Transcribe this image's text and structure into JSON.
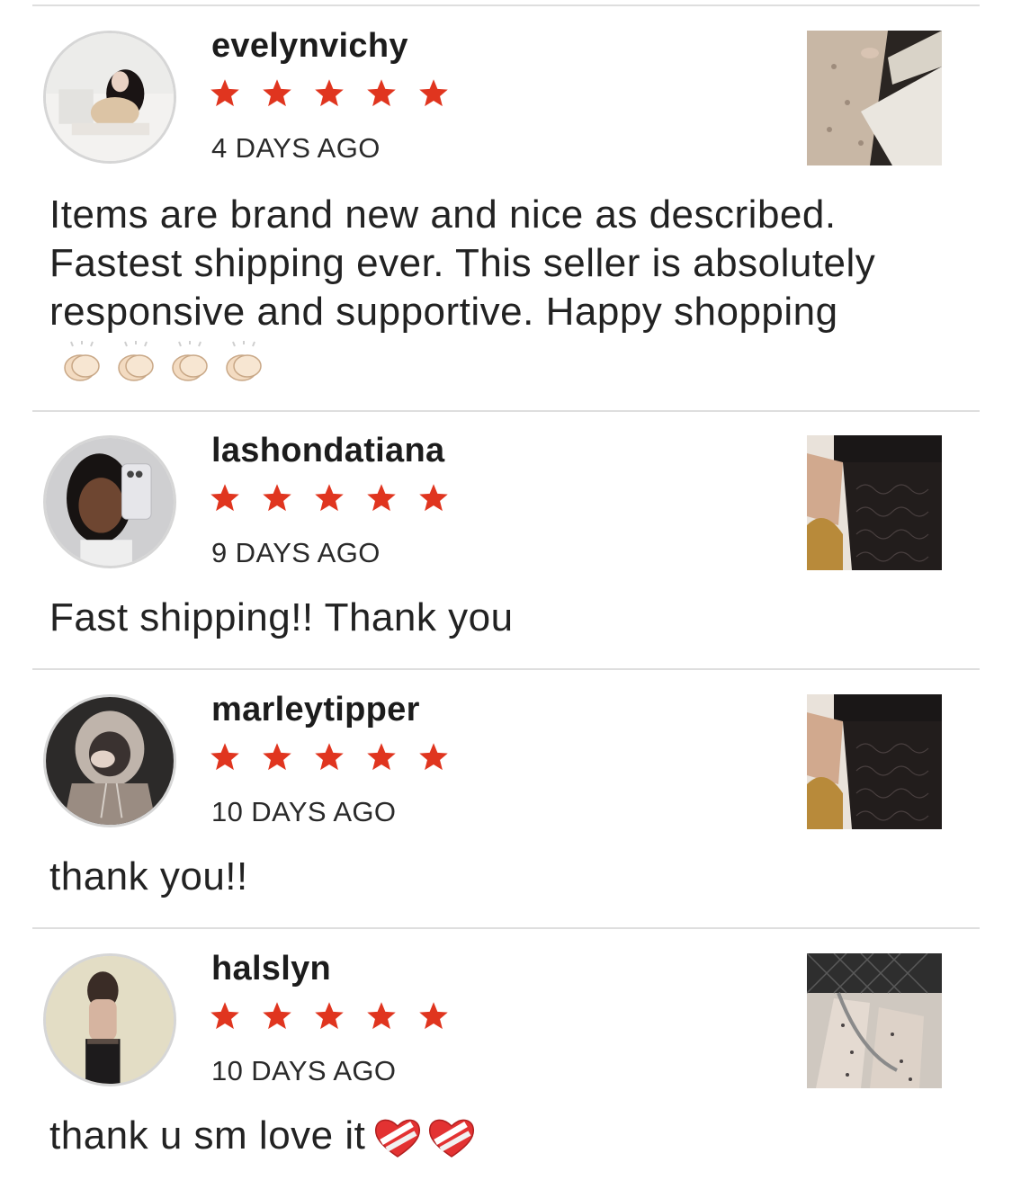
{
  "colors": {
    "star": "#e0351f",
    "divider": "#dedede",
    "text": "#1c1c1c"
  },
  "reviews": [
    {
      "username": "evelynvichy",
      "rating": 5,
      "date": "4 DAYS AGO",
      "text": "Items are brand new and nice as described. Fastest shipping ever. This seller is absolutely responsive and supportive. Happy shopping",
      "emoji": [
        "clapping-hands-icon",
        "clapping-hands-icon",
        "clapping-hands-icon",
        "clapping-hands-icon"
      ]
    },
    {
      "username": "lashondatiana",
      "rating": 5,
      "date": "9 DAYS AGO",
      "text": "Fast shipping!! Thank you",
      "emoji": []
    },
    {
      "username": "marleytipper",
      "rating": 5,
      "date": "10 DAYS AGO",
      "text": "thank you!!",
      "emoji": []
    },
    {
      "username": "halslyn",
      "rating": 5,
      "date": "10 DAYS AGO",
      "text": "thank u sm love it",
      "emoji": [
        "mending-heart-icon",
        "mending-heart-icon"
      ]
    }
  ]
}
